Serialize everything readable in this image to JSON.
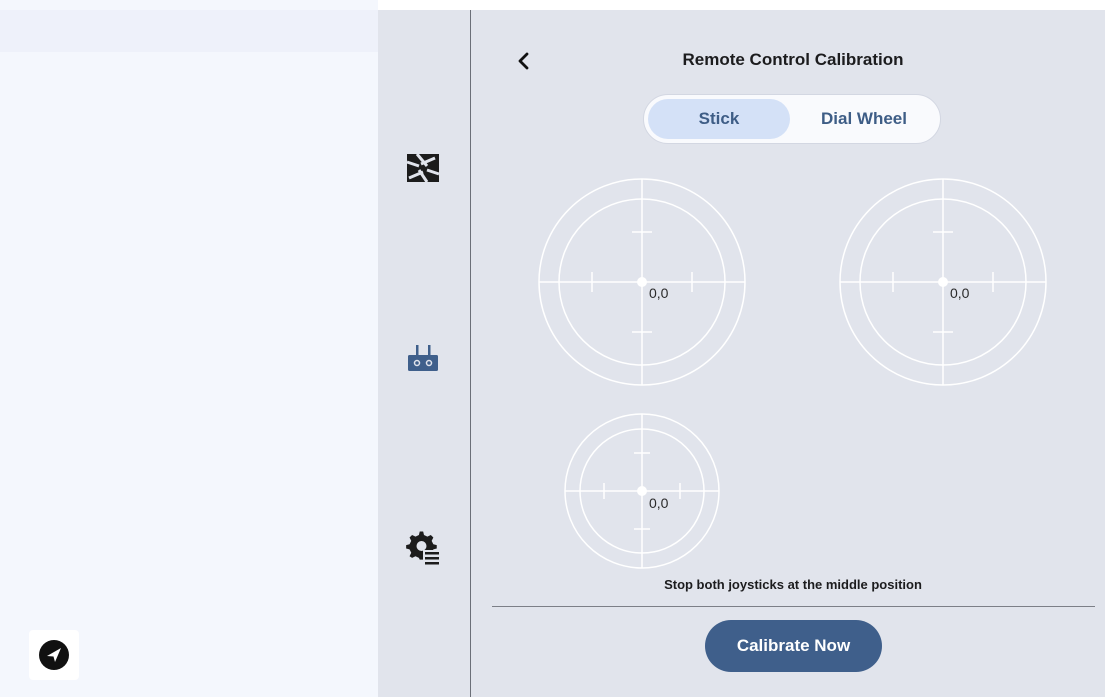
{
  "header": {
    "title": "Remote Control Calibration"
  },
  "tabs": [
    {
      "label": "Stick",
      "active": true
    },
    {
      "label": "Dial Wheel",
      "active": false
    }
  ],
  "sticks": {
    "left": {
      "value": "0,0"
    },
    "right": {
      "value": "0,0"
    },
    "dial": {
      "value": "0,0"
    }
  },
  "hint": "Stop both joysticks at the middle position",
  "actions": {
    "calibrate_label": "Calibrate Now"
  },
  "sidebar": {
    "items": [
      {
        "icon": "camera-aperture-icon"
      },
      {
        "icon": "remote-controller-icon"
      },
      {
        "icon": "settings-gear-list-icon"
      }
    ]
  },
  "bottom_nav": {
    "icon": "navigation-arrow-icon"
  },
  "colors": {
    "accent": "#3f5f8b",
    "tab_active_bg": "#d4e1f7",
    "panel_bg": "#e1e4ec",
    "left_bg": "#f4f7fd"
  }
}
